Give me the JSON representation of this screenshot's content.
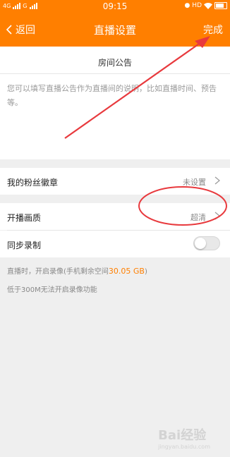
{
  "status_bar": {
    "net1": "4G",
    "net2": "G",
    "time": "09:15",
    "hd": "HD"
  },
  "nav": {
    "back_label": "返回",
    "title": "直播设置",
    "done_label": "完成"
  },
  "notice": {
    "title": "房间公告",
    "placeholder": "您可以填写直播公告作为直播间的说明，比如直播时间、预告等。"
  },
  "settings": {
    "fan_badge": {
      "label": "我的粉丝徽章",
      "value": "未设置"
    },
    "quality": {
      "label": "开播画质",
      "value": "超清"
    },
    "sync_record": {
      "label": "同步录制",
      "enabled": false
    }
  },
  "notes": {
    "line1_prefix": "直播时，开启录像(手机剩余空间",
    "line1_space": "30.05 GB",
    "line1_suffix": ")",
    "line2": "低于300M无法开启录像功能"
  },
  "watermark": {
    "text": "Bai经验",
    "url": "jingyan.baidu.com"
  },
  "colors": {
    "accent": "#ff7f00",
    "annotation": "#e8393d"
  }
}
